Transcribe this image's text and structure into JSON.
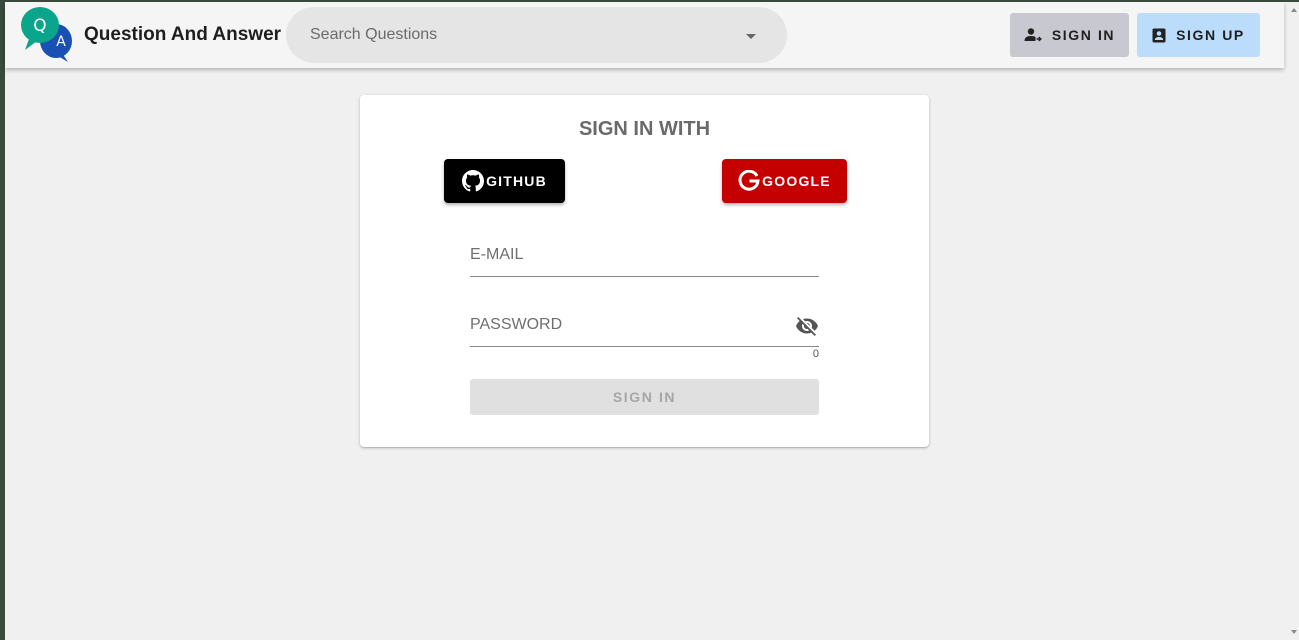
{
  "header": {
    "brand": "Question And Answer",
    "logo_letters": {
      "q": "Q",
      "a": "A"
    },
    "search": {
      "placeholder": "Search Questions"
    },
    "signin_label": "SIGN IN",
    "signup_label": "SIGN UP"
  },
  "login": {
    "title": "SIGN IN WITH",
    "github_label": "GITHUB",
    "google_label": "GOOGLE",
    "email_label": "E-MAIL",
    "password_label": "PASSWORD",
    "password_counter": "0",
    "submit_label": "SIGN IN"
  },
  "colors": {
    "github": "#000000",
    "google": "#c40000",
    "logo_green": "#0aa58a",
    "logo_blue": "#1a4fb4",
    "signup_bg": "#bcdcfb",
    "signin_bg": "#c8c8d0"
  },
  "icons": {
    "logo": "qa-bubbles-icon",
    "search_caret": "caret-down-icon",
    "signin": "person-arrow-icon",
    "signup": "contact-card-icon",
    "github": "github-icon",
    "google": "google-g-icon",
    "password_toggle": "eye-off-icon"
  }
}
